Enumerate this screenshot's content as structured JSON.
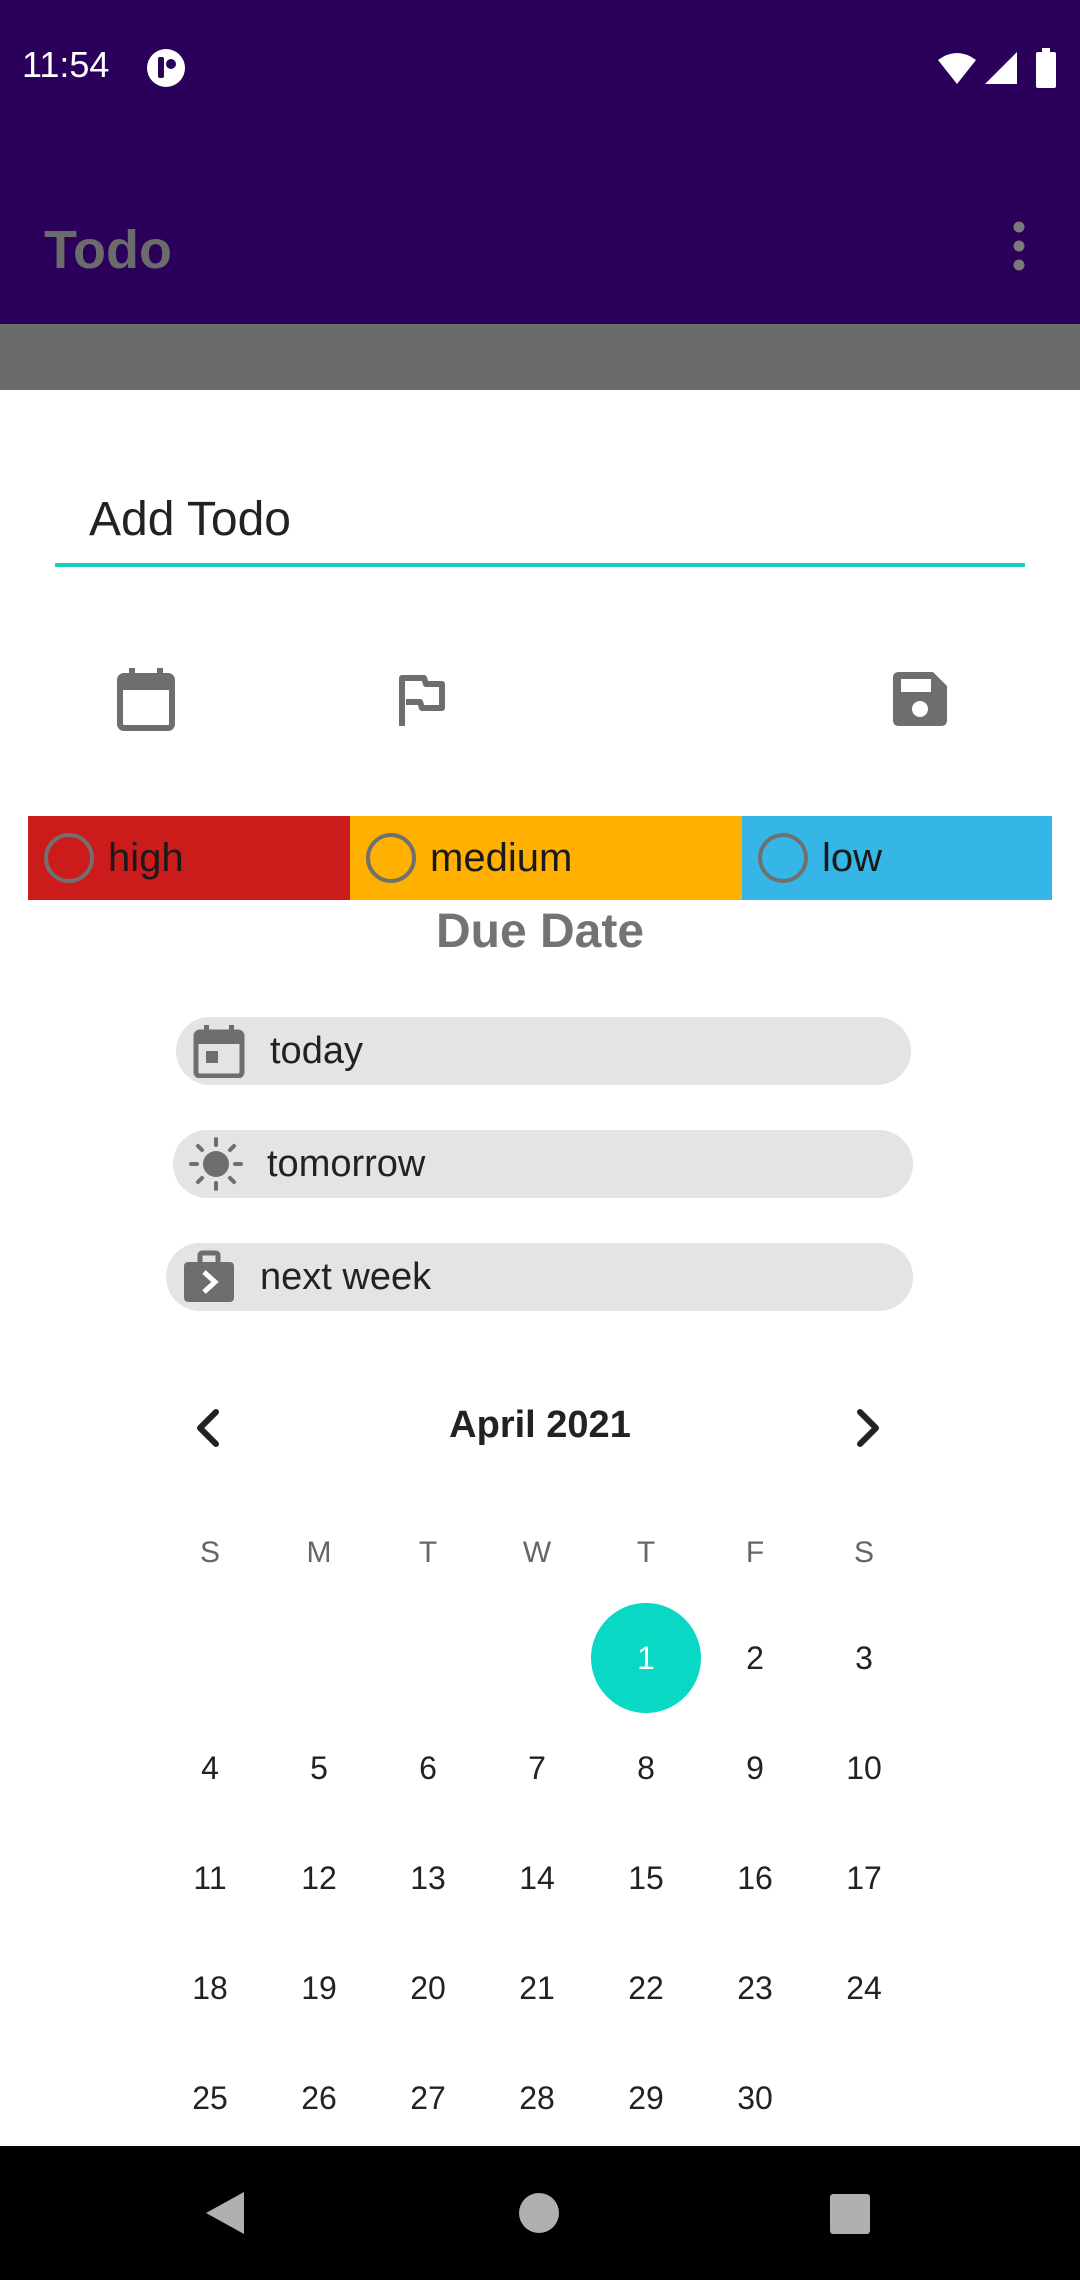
{
  "status_bar": {
    "time": "11:54"
  },
  "app_bar": {
    "title": "Todo"
  },
  "todo_input": {
    "value": "",
    "placeholder": "Add Todo"
  },
  "toolbar": {
    "icons": [
      "calendar-icon",
      "flag-icon",
      "save-icon"
    ]
  },
  "priority": [
    {
      "label": "high",
      "color": "#cc1b1b"
    },
    {
      "label": "medium",
      "color": "#ffb000"
    },
    {
      "label": "low",
      "color": "#35b6e6"
    }
  ],
  "due_date": {
    "heading": "Due Date",
    "options": [
      {
        "label": "today",
        "icon": "calendar-today-icon"
      },
      {
        "label": "tomorrow",
        "icon": "sun-icon"
      },
      {
        "label": "next week",
        "icon": "briefcase-arrow-icon"
      }
    ]
  },
  "calendar": {
    "month_label": "April 2021",
    "weekdays": [
      "S",
      "M",
      "T",
      "W",
      "T",
      "F",
      "S"
    ],
    "selected_day": "1",
    "accent": "#08d8c4",
    "weeks": [
      [
        "",
        "",
        "",
        "",
        "1",
        "2",
        "3"
      ],
      [
        "4",
        "5",
        "6",
        "7",
        "8",
        "9",
        "10"
      ],
      [
        "11",
        "12",
        "13",
        "14",
        "15",
        "16",
        "17"
      ],
      [
        "18",
        "19",
        "20",
        "21",
        "22",
        "23",
        "24"
      ],
      [
        "25",
        "26",
        "27",
        "28",
        "29",
        "30",
        ""
      ]
    ]
  },
  "colors": {
    "app_bar": "#2b005a",
    "input_underline": "#19cfc1"
  }
}
